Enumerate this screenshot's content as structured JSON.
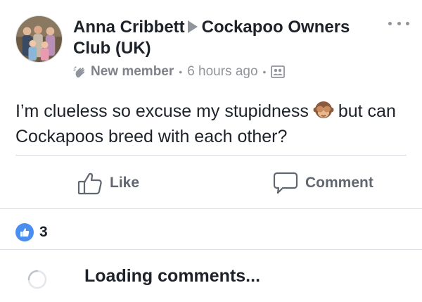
{
  "post": {
    "author": "Anna Cribbett",
    "group": "Cockapoo Owners Club (UK)",
    "badge": "New member",
    "timestamp": "6 hours ago",
    "text_before_emoji": "I’m clueless so excuse my stupidness",
    "text_after_emoji": "but can Cockapoos breed with each other?",
    "emoji": "see-no-evil-monkey-icon",
    "audience_icon": "group-icon"
  },
  "actions": {
    "like_label": "Like",
    "comment_label": "Comment"
  },
  "reactions": {
    "count": "3",
    "type": "like"
  },
  "comments": {
    "loading_label": "Loading comments..."
  },
  "colors": {
    "primary_text": "#1d2129",
    "secondary_text": "#90949c",
    "action_text": "#606770",
    "like_blue": "#4a8ef0",
    "divider": "#dadde1"
  }
}
